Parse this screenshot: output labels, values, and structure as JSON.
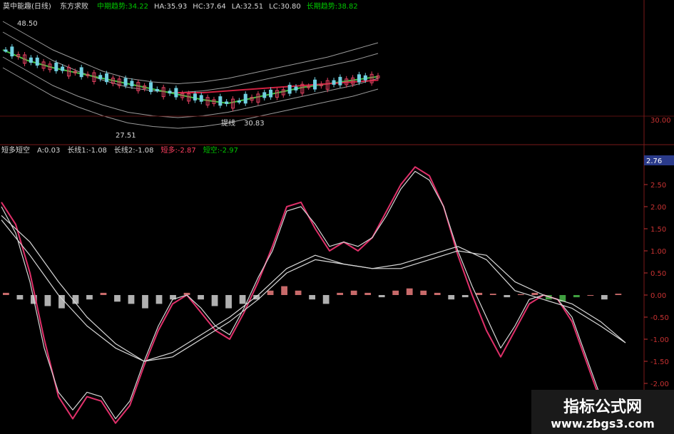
{
  "upper_panel": {
    "name": "莫中能趣(日线)",
    "subtitle": "东方求败",
    "legend": [
      {
        "label": "中期趋势:",
        "value": "34.22",
        "color": "#00c800"
      },
      {
        "label": "HA:",
        "value": "35.93",
        "color": "#d8d8d8"
      },
      {
        "label": "HC:",
        "value": "37.64",
        "color": "#d8d8d8"
      },
      {
        "label": "LA:",
        "value": "32.51",
        "color": "#d8d8d8"
      },
      {
        "label": "LC:",
        "value": "30.80",
        "color": "#d8d8d8"
      },
      {
        "label": "长期趋势:",
        "value": "38.82",
        "color": "#00c800"
      }
    ],
    "annotations": {
      "high": "48.50",
      "low": "27.51",
      "mid": "30.83",
      "mid_label": "提线"
    },
    "axis_label": "30.00"
  },
  "lower_panel": {
    "name": "短多短空",
    "legend": [
      {
        "label": "A:",
        "value": "0.03",
        "color": "#d8d8d8"
      },
      {
        "label": "长线1:",
        "value": "-1.08",
        "color": "#d8d8d8"
      },
      {
        "label": "长线2:",
        "value": "-1.08",
        "color": "#d8d8d8"
      },
      {
        "label": "短多:",
        "value": "-2.87",
        "color": "#ff4060"
      },
      {
        "label": "短空:",
        "value": "-2.97",
        "color": "#00c800"
      }
    ],
    "current_value_tag": "2.76"
  },
  "chart_data": {
    "type": "line",
    "y_ticks": [
      "2.50",
      "2.00",
      "1.50",
      "1.00",
      "0.50",
      "0.00",
      "-0.50",
      "-1.00",
      "-1.50",
      "-2.00",
      "-2.50"
    ],
    "ylim": [
      -3.0,
      3.0
    ],
    "series": [
      {
        "name": "短多",
        "color": "#e0306a",
        "x": [
          0,
          20,
          40,
          60,
          80,
          100,
          120,
          140,
          160,
          180,
          200,
          220,
          240,
          260,
          280,
          300,
          320,
          340,
          360,
          380,
          400,
          420,
          440,
          460,
          480,
          500,
          520,
          540,
          560,
          580,
          600,
          620,
          640,
          660,
          680,
          700,
          720,
          740,
          760,
          780,
          800,
          820,
          840,
          860
        ],
        "values": [
          2.1,
          1.6,
          0.5,
          -1.0,
          -2.3,
          -2.8,
          -2.3,
          -2.4,
          -2.9,
          -2.5,
          -1.6,
          -0.8,
          -0.2,
          0.0,
          -0.4,
          -0.8,
          -1.0,
          -0.4,
          0.3,
          1.1,
          2.0,
          2.1,
          1.5,
          1.0,
          1.2,
          1.0,
          1.3,
          1.9,
          2.5,
          2.9,
          2.7,
          2.0,
          0.9,
          0.0,
          -0.8,
          -1.4,
          -0.8,
          -0.2,
          0.0,
          -0.1,
          -0.6,
          -1.5,
          -2.4,
          -3.0
        ]
      },
      {
        "name": "短空",
        "color": "#d8d8d8",
        "x": [
          0,
          20,
          40,
          60,
          80,
          100,
          120,
          140,
          160,
          180,
          200,
          220,
          240,
          260,
          280,
          300,
          320,
          340,
          360,
          380,
          400,
          420,
          440,
          460,
          480,
          500,
          520,
          540,
          560,
          580,
          600,
          620,
          640,
          660,
          680,
          700,
          720,
          740,
          760,
          780,
          800,
          820,
          840,
          860
        ],
        "values": [
          2.0,
          1.4,
          0.3,
          -1.2,
          -2.2,
          -2.6,
          -2.2,
          -2.3,
          -2.8,
          -2.4,
          -1.5,
          -0.7,
          -0.1,
          0.0,
          -0.3,
          -0.7,
          -0.9,
          -0.3,
          0.4,
          1.0,
          1.9,
          2.0,
          1.6,
          1.1,
          1.2,
          1.1,
          1.3,
          1.8,
          2.4,
          2.8,
          2.6,
          2.0,
          1.0,
          0.2,
          -0.5,
          -1.2,
          -0.7,
          -0.1,
          0.0,
          -0.1,
          -0.5,
          -1.4,
          -2.3,
          -2.97
        ]
      },
      {
        "name": "长线1",
        "color": "#d8d8d8",
        "x": [
          0,
          40,
          80,
          120,
          160,
          200,
          240,
          280,
          320,
          360,
          400,
          440,
          480,
          520,
          560,
          600,
          640,
          680,
          720,
          760,
          800,
          840,
          875
        ],
        "values": [
          1.7,
          0.9,
          0.0,
          -0.7,
          -1.2,
          -1.5,
          -1.3,
          -0.9,
          -0.5,
          0.0,
          0.6,
          0.9,
          0.7,
          0.6,
          0.7,
          0.9,
          1.1,
          0.8,
          0.1,
          -0.1,
          -0.3,
          -0.7,
          -1.08
        ]
      },
      {
        "name": "长线2",
        "color": "#d8d8d8",
        "x": [
          0,
          40,
          80,
          120,
          160,
          200,
          240,
          280,
          320,
          360,
          400,
          440,
          480,
          520,
          560,
          600,
          640,
          680,
          720,
          760,
          800,
          840,
          875
        ],
        "values": [
          1.8,
          1.2,
          0.3,
          -0.5,
          -1.1,
          -1.5,
          -1.4,
          -1.0,
          -0.6,
          -0.1,
          0.5,
          0.8,
          0.7,
          0.6,
          0.6,
          0.8,
          1.0,
          0.9,
          0.3,
          0.0,
          -0.2,
          -0.6,
          -1.08
        ]
      }
    ],
    "histogram": {
      "name": "A",
      "values": [
        0.05,
        -0.1,
        -0.2,
        -0.25,
        -0.3,
        -0.2,
        -0.1,
        0.05,
        -0.15,
        -0.2,
        -0.3,
        -0.2,
        -0.1,
        0.05,
        -0.1,
        -0.25,
        -0.3,
        -0.2,
        -0.1,
        0.1,
        0.2,
        0.1,
        -0.1,
        -0.2,
        0.05,
        0.1,
        0.05,
        -0.05,
        0.1,
        0.15,
        0.1,
        0.05,
        -0.1,
        -0.05,
        0.05,
        0.03,
        -0.05,
        0.02,
        0.05,
        -0.1,
        -0.15,
        -0.05,
        0.0,
        -0.1,
        0.03
      ]
    },
    "price_panel": {
      "bands": [
        {
          "name": "HC",
          "values": [
            56,
            52,
            48,
            45,
            42,
            40,
            39,
            38.5,
            39,
            40,
            41.5,
            43,
            44.5,
            46,
            48,
            50
          ]
        },
        {
          "name": "HA",
          "values": [
            53,
            49,
            45,
            42,
            39.5,
            37.5,
            36.5,
            36,
            36.5,
            37.5,
            39,
            40.5,
            42,
            43.5,
            45,
            47
          ]
        },
        {
          "name": "LA",
          "values": [
            46,
            42,
            38,
            35,
            32.5,
            30.5,
            29.5,
            29,
            29.5,
            30.5,
            32,
            33.5,
            35,
            36.5,
            38,
            40
          ]
        },
        {
          "name": "LC",
          "values": [
            43,
            39,
            35,
            32,
            29.5,
            27.5,
            26.5,
            26,
            26.5,
            27.5,
            29,
            30.5,
            32,
            33.5,
            35,
            37
          ]
        }
      ],
      "mid_trend": [
        48,
        45,
        43,
        41.5,
        40,
        38.5,
        37,
        35.5,
        34,
        33,
        34.5,
        36,
        37.5,
        38.5,
        39.5,
        40.5
      ],
      "long_trend": [
        null,
        null,
        null,
        null,
        null,
        null,
        null,
        36,
        36,
        36.5,
        37,
        37.5,
        38,
        38.5,
        39,
        39.5
      ]
    }
  }
}
